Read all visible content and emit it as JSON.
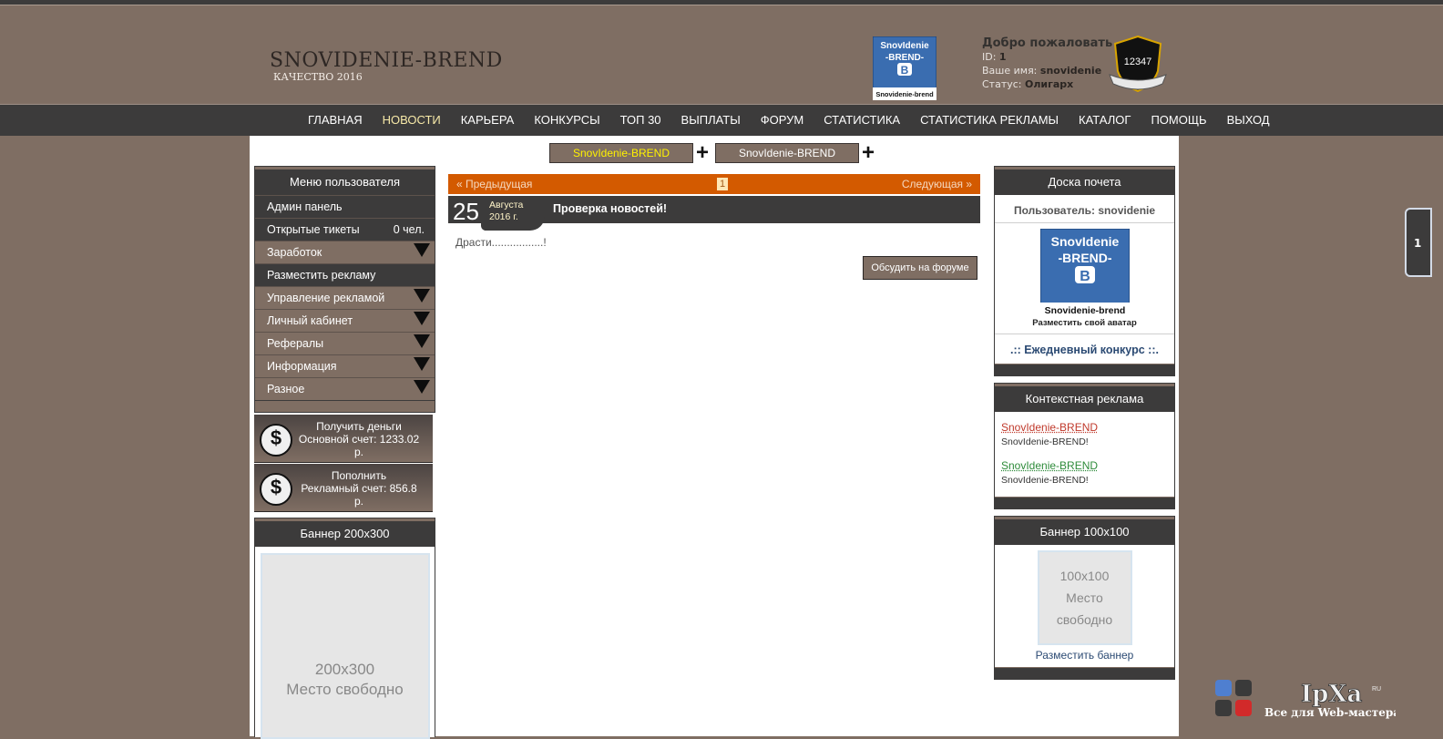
{
  "header": {
    "site_title": "SNOVIDENIE-BREND",
    "site_subtitle": "КАЧЕСТВО 2016",
    "welcome": {
      "title": "Добро пожаловать",
      "id_label": "ID:",
      "id_value": "1",
      "name_label": "Ваше имя:",
      "name_value": "snovidenie",
      "status_label": "Статус:",
      "status_value": "Олигарх"
    },
    "badge_number": "12347",
    "avatar": {
      "line1": "SnovIdenie",
      "line2": "-BREND-",
      "letter": "B",
      "caption": "Snovidenie-brend"
    }
  },
  "nav": {
    "items": [
      {
        "label": "ГЛАВНАЯ"
      },
      {
        "label": "НОВОСТИ"
      },
      {
        "label": "КАРЬЕРА"
      },
      {
        "label": "КОНКУРСЫ"
      },
      {
        "label": "ТОП 30"
      },
      {
        "label": "ВЫПЛАТЫ"
      },
      {
        "label": "ФОРУМ"
      },
      {
        "label": "СТАТИСТИКА"
      },
      {
        "label": "СТАТИСТИКА РЕКЛАМЫ"
      },
      {
        "label": "КАТАЛОГ"
      },
      {
        "label": "ПОМОЩЬ"
      },
      {
        "label": "ВЫХОД"
      }
    ],
    "active": "НОВОСТИ"
  },
  "tabs": [
    {
      "label": "SnovIdenie-BREND"
    },
    {
      "label": "SnovIdenie-BREND"
    }
  ],
  "user_menu": {
    "title": "Меню пользователя",
    "items": [
      {
        "label": "Админ панель"
      },
      {
        "label": "Открытые тикеты",
        "count": "0 чел."
      },
      {
        "label": "Заработок"
      },
      {
        "label": "Разместить рекламу"
      },
      {
        "label": "Управление рекламой"
      },
      {
        "label": "Личный кабинет"
      },
      {
        "label": "Рефералы"
      },
      {
        "label": "Информация"
      },
      {
        "label": "Разное"
      }
    ]
  },
  "balance": {
    "main": {
      "line1": "Получить деньги",
      "line2": "Основной счет: 1233.02",
      "line3": "р."
    },
    "ads": {
      "line1": "Пополнить",
      "line2": "Рекламный счет: 856.8",
      "line3": "р."
    },
    "coin_symbol": "$"
  },
  "banner_left": {
    "title": "Баннер 200x300",
    "size": "200x300",
    "text": "Место свободно"
  },
  "news": {
    "prev": "« Предыдущая",
    "next": "Следующая »",
    "page": "1",
    "day": "25",
    "month": "Августа",
    "year": "2016 г.",
    "title": "Проверка новостей!",
    "body": "Драсти.................!",
    "discuss_button": "Обсудить на форуме"
  },
  "honor_board": {
    "title": "Доска почета",
    "user_line": "Пользователь: snovidenie",
    "avatar_caption": "Разместить свой аватар",
    "contest_link": ".:: Ежедневный конкурс ::."
  },
  "context_ads": {
    "title": "Контекстная реклама",
    "ads": [
      {
        "title": "SnovIdenie-BREND",
        "desc": "SnovIdenie-BREND!",
        "color": "#c0392b"
      },
      {
        "title": "SnovIdenie-BREND",
        "desc": "SnovIdenie-BREND!",
        "color": "#2e8b3a"
      }
    ]
  },
  "banner_right": {
    "title": "Баннер 100x100",
    "size": "100x100",
    "line1": "Место",
    "line2": "свободно",
    "link": "Разместить баннер"
  },
  "side_tab": "1",
  "watermark": {
    "brand": "IpXa",
    "tld": "RU",
    "slogan": "Все для Web-мастера"
  },
  "colors": {
    "page_bg": "#7f6e63",
    "dark": "#3c3b3b",
    "accent_orange": "#d35a00",
    "active_nav": "#f7e9a8",
    "active_tab": "#fff200"
  }
}
